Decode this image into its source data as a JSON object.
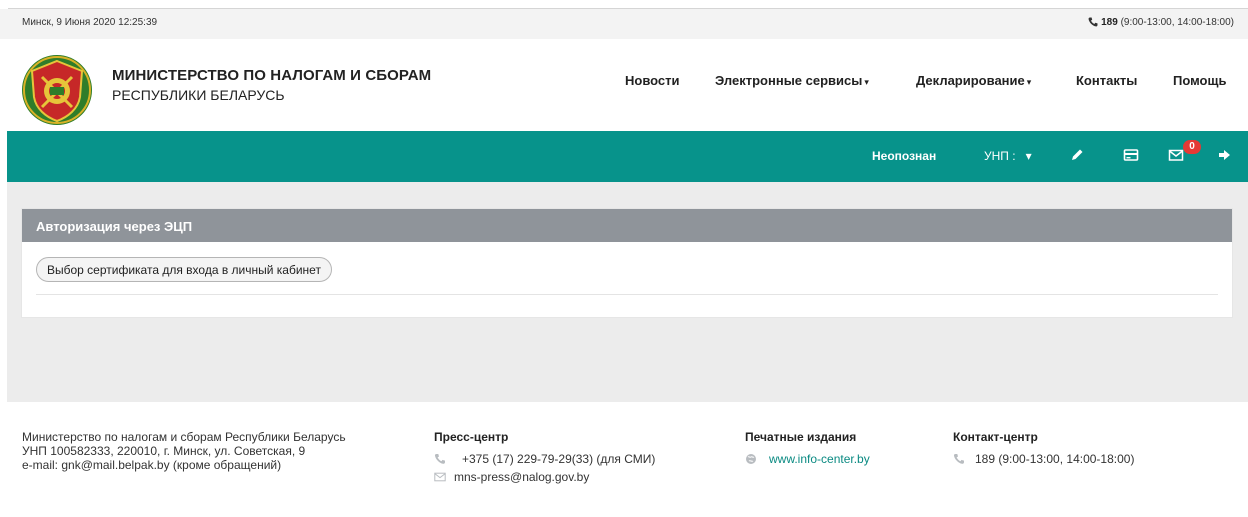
{
  "topbar": {
    "datetime": "Минск, 9 Июня 2020 12:25:39",
    "phone_number": "189",
    "phone_hours": "(9:00-13:00, 14:00-18:00)"
  },
  "header": {
    "brand_line1": "МИНИСТЕРСТВО ПО НАЛОГАМ И СБОРАМ",
    "brand_line2": "РЕСПУБЛИКИ БЕЛАРУСЬ",
    "nav": [
      {
        "label": "Новости"
      },
      {
        "label": "Электронные сервисы",
        "dropdown": true
      },
      {
        "label": "Декларирование",
        "dropdown": true
      },
      {
        "label": "Контакты"
      },
      {
        "label": "Помощь"
      }
    ],
    "caret": "▾"
  },
  "userbar": {
    "status": "Неопознан",
    "unp_label": "УНП :",
    "unp_caret": "▾",
    "messages_count": "0"
  },
  "auth_panel": {
    "title": "Авторизация через ЭЦП",
    "select_cert_button": "Выбор сертификата для входа в личный кабинет"
  },
  "footer": {
    "org": {
      "line1": "Министерство по налогам и сборам Республики Беларусь",
      "line2": "УНП 100582333, 220010, г. Минск, ул. Советская, 9",
      "line3": "e-mail: gnk@mail.belpak.by (кроме обращений)"
    },
    "press": {
      "title": "Пресс-центр",
      "phone": "+375 (17) 229-79-29(33) (для СМИ)",
      "email": "mns-press@nalog.gov.by"
    },
    "print": {
      "title": "Печатные издания",
      "site": "www.info-center.by"
    },
    "contact": {
      "title": "Контакт-центр",
      "phone": "189 (9:00-13:00, 14:00-18:00)"
    }
  },
  "colors": {
    "primary": "#07938b",
    "panel_header": "#8f949a",
    "badge": "#e53935",
    "link": "#0a8a82"
  },
  "icons": [
    "phone-icon",
    "ministry-emblem-icon",
    "edit-pencil-icon",
    "card-icon",
    "mail-icon",
    "logout-icon",
    "globe-icon",
    "email-icon"
  ]
}
